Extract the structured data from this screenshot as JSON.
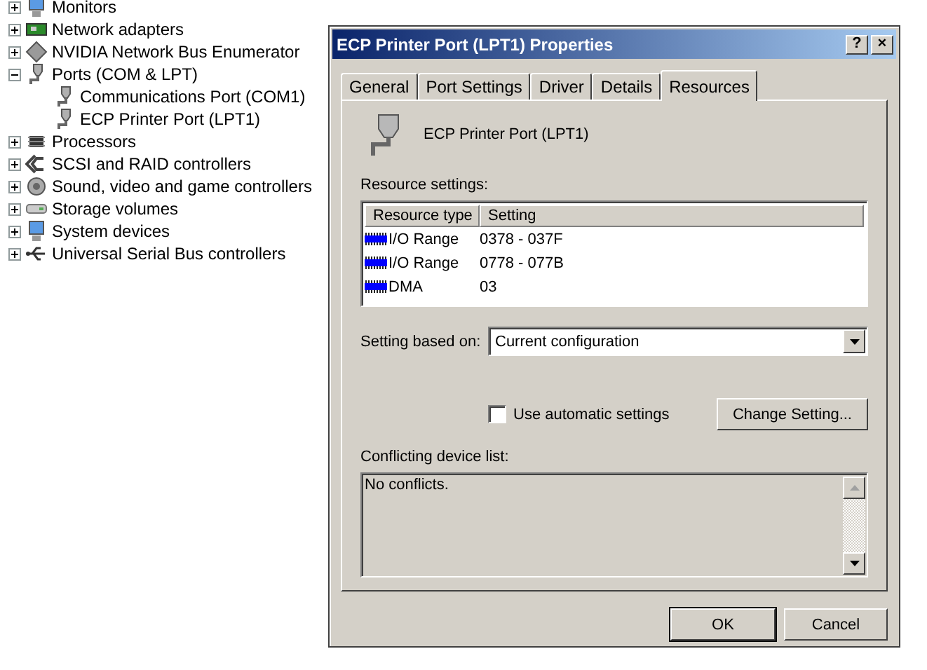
{
  "device_tree": {
    "items": [
      {
        "label": "Monitors",
        "kind": "monitor",
        "expanded": false
      },
      {
        "label": "Network adapters",
        "kind": "card",
        "expanded": false
      },
      {
        "label": "NVIDIA Network Bus Enumerator",
        "kind": "diamond",
        "expanded": false
      },
      {
        "label": "Ports (COM & LPT)",
        "kind": "port",
        "expanded": true,
        "children": [
          {
            "label": "Communications Port (COM1)",
            "kind": "port"
          },
          {
            "label": "ECP Printer Port (LPT1)",
            "kind": "port"
          }
        ]
      },
      {
        "label": "Processors",
        "kind": "chip",
        "expanded": false
      },
      {
        "label": "SCSI and RAID controllers",
        "kind": "scsi",
        "expanded": false
      },
      {
        "label": "Sound, video and game controllers",
        "kind": "speaker",
        "expanded": false
      },
      {
        "label": "Storage volumes",
        "kind": "drive",
        "expanded": false
      },
      {
        "label": "System devices",
        "kind": "monitor",
        "expanded": false
      },
      {
        "label": "Universal Serial Bus controllers",
        "kind": "usb",
        "expanded": false
      }
    ]
  },
  "dialog": {
    "title": "ECP Printer Port (LPT1) Properties",
    "help_button": "?",
    "close_button": "×",
    "tabs": [
      {
        "label": "General",
        "selected": false
      },
      {
        "label": "Port Settings",
        "selected": false
      },
      {
        "label": "Driver",
        "selected": false
      },
      {
        "label": "Details",
        "selected": false
      },
      {
        "label": "Resources",
        "selected": true
      }
    ],
    "device_name": "ECP Printer Port (LPT1)",
    "resource_settings_label": "Resource settings:",
    "resource_table": {
      "columns": [
        "Resource type",
        "Setting"
      ],
      "rows": [
        {
          "type": "I/O Range",
          "setting": "0378 - 037F"
        },
        {
          "type": "I/O Range",
          "setting": "0778 - 077B"
        },
        {
          "type": "DMA",
          "setting": "03"
        }
      ]
    },
    "setting_based_on": {
      "label": "Setting based on:",
      "value": "Current configuration"
    },
    "automatic_settings": {
      "label": "Use automatic settings",
      "checked": false
    },
    "change_setting_button": "Change Setting...",
    "conflicts": {
      "label": "Conflicting device list:",
      "text": "No conflicts."
    },
    "buttons": [
      {
        "label": "OK",
        "default": true
      },
      {
        "label": "Cancel",
        "default": false
      }
    ]
  }
}
